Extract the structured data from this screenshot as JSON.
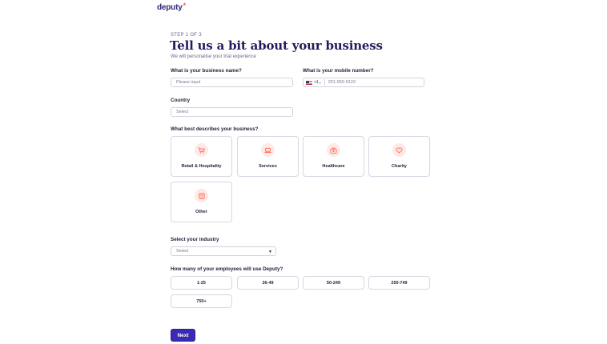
{
  "brand": {
    "logo_text": "deputy",
    "logo_mark": "*",
    "accent": "#ff5a47",
    "primary": "#3a2bb4"
  },
  "header": {
    "step": "STEP 1 OF 3",
    "title": "Tell us a bit about your business",
    "subtitle": "We will personalise your trial experience"
  },
  "business_name": {
    "label": "What is your business name?",
    "placeholder": "Please input"
  },
  "mobile": {
    "label": "What is your mobile number?",
    "country_code": "+1",
    "flag": "us-flag-icon",
    "placeholder": "201-555-0123"
  },
  "country": {
    "label": "Country",
    "placeholder": "Select"
  },
  "business_type": {
    "label": "What best describes your business?",
    "options": [
      {
        "label": "Retail & Hospitality",
        "icon": "cart-icon"
      },
      {
        "label": "Services",
        "icon": "laptop-icon"
      },
      {
        "label": "Healthcare",
        "icon": "medical-bag-icon"
      },
      {
        "label": "Charity",
        "icon": "heart-icon"
      },
      {
        "label": "Other",
        "icon": "building-icon"
      }
    ]
  },
  "industry": {
    "label": "Select your industry",
    "value": "Select"
  },
  "employees": {
    "label": "How many of your employees will use Deputy?",
    "options": [
      "1-25",
      "26-49",
      "50-249",
      "250-749",
      "750+"
    ]
  },
  "actions": {
    "next_label": "Next"
  }
}
